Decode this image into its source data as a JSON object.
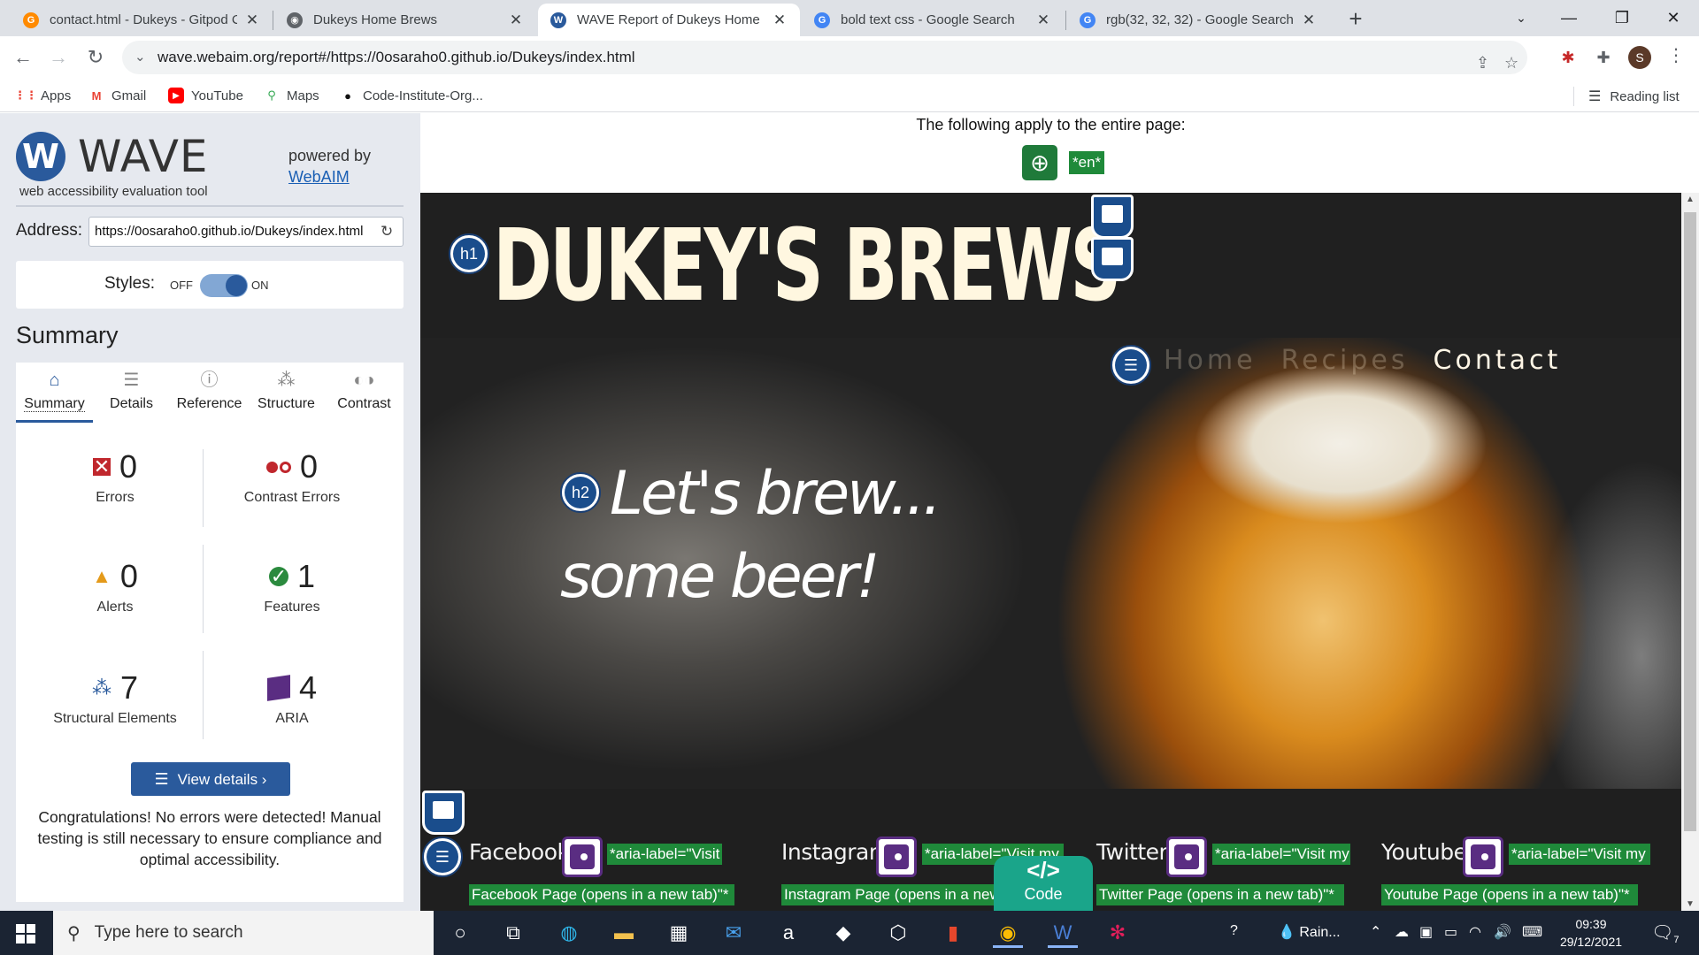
{
  "browser": {
    "tabs": [
      {
        "title": "contact.html - Dukeys - Gitpod C",
        "favicon": "gitpod-icon",
        "color": "#ff8a00",
        "glyph": "G"
      },
      {
        "title": "Dukeys Home Brews",
        "favicon": "globe-icon",
        "color": "#5f6368",
        "glyph": "◉"
      },
      {
        "title": "WAVE Report of Dukeys Home Br",
        "favicon": "wave-icon",
        "color": "#2a5a9c",
        "glyph": "W"
      },
      {
        "title": "bold text css - Google Search",
        "favicon": "google-icon",
        "color": "#4285f4",
        "glyph": "G"
      },
      {
        "title": "rgb(32, 32, 32) - Google Search",
        "favicon": "google-icon",
        "color": "#4285f4",
        "glyph": "G"
      }
    ],
    "active_tab": 2,
    "url": "wave.webaim.org/report#/https://0osaraho0.github.io/Dukeys/index.html",
    "profile_initial": "S",
    "bookmarks": [
      {
        "label": "Apps",
        "icon": "apps-grid-icon"
      },
      {
        "label": "Gmail",
        "icon": "gmail-icon"
      },
      {
        "label": "YouTube",
        "icon": "youtube-icon"
      },
      {
        "label": "Maps",
        "icon": "maps-pin-icon"
      },
      {
        "label": "Code-Institute-Org...",
        "icon": "github-icon"
      }
    ],
    "reading_list": "Reading list"
  },
  "wave": {
    "logo_word": "WAVE",
    "tagline": "web accessibility evaluation tool",
    "powered_by": "powered by",
    "webaim_link": "WebAIM",
    "address_label": "Address:",
    "address_value": "https://0osaraho0.github.io/Dukeys/index.html",
    "styles_label": "Styles:",
    "styles_off": "OFF",
    "styles_on": "ON",
    "styles_enabled": true,
    "summary_heading": "Summary",
    "tabs": [
      {
        "label": "Summary",
        "icon": "home-icon"
      },
      {
        "label": "Details",
        "icon": "list-icon"
      },
      {
        "label": "Reference",
        "icon": "info-icon"
      },
      {
        "label": "Structure",
        "icon": "hierarchy-icon"
      },
      {
        "label": "Contrast",
        "icon": "contrast-icon"
      }
    ],
    "active_tab": "Summary",
    "stats": {
      "errors": {
        "value": "0",
        "label": "Errors"
      },
      "contrast_errors": {
        "value": "0",
        "label": "Contrast Errors"
      },
      "alerts": {
        "value": "0",
        "label": "Alerts"
      },
      "features": {
        "value": "1",
        "label": "Features"
      },
      "structural": {
        "value": "7",
        "label": "Structural Elements"
      },
      "aria": {
        "value": "4",
        "label": "ARIA"
      }
    },
    "view_details": "View details ›",
    "congrats": "Congratulations! No errors were detected! Manual testing is still necessary to ensure compliance and optimal accessibility."
  },
  "preview": {
    "apply_text": "The following apply to the entire page:",
    "lang_tag": "*en*",
    "site_title": "DUKEY'S BREWS",
    "h1_badge": "h1",
    "h2_badge": "h2",
    "nav": [
      "Home",
      "Recipes",
      "Contact"
    ],
    "hero_line1": "Let's brew...",
    "hero_line2": "some beer!",
    "social": [
      {
        "name": "Facebook",
        "aria_line1": "*aria-label=\"Visit my",
        "aria_line2": "Facebook Page (opens in a new tab)\"*"
      },
      {
        "name": "Instagram",
        "aria_line1": "*aria-label=\"Visit my",
        "aria_line2": "Instagram Page (opens in a new tab)\"*"
      },
      {
        "name": "Twitter",
        "aria_line1": "*aria-label=\"Visit my",
        "aria_line2": "Twitter Page (opens in a new tab)\"*"
      },
      {
        "name": "Youtube",
        "aria_line1": "*aria-label=\"Visit my",
        "aria_line2": "Youtube Page (opens in a new tab)\"*"
      }
    ],
    "code_glyph": "</>",
    "code_label": "Code"
  },
  "taskbar": {
    "search_placeholder": "Type here to search",
    "weather": "Rain...",
    "time": "09:39",
    "date": "29/12/2021",
    "notifications": "7"
  }
}
